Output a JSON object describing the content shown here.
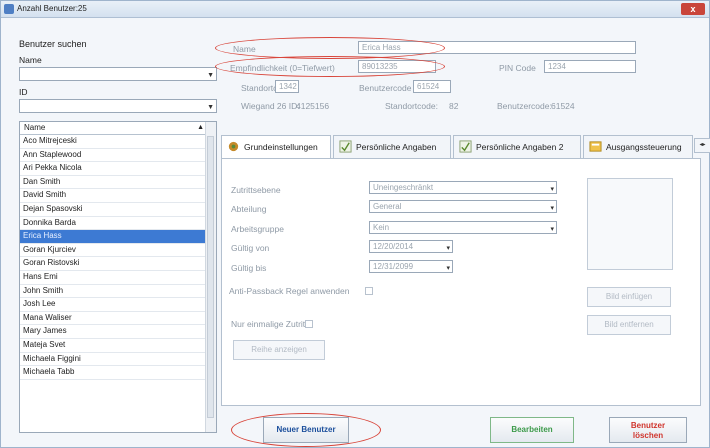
{
  "window": {
    "title": "Anzahl Benutzer:25",
    "close_glyph": "x"
  },
  "search": {
    "heading": "Benutzer suchen",
    "name_label": "Name",
    "id_label": "ID",
    "name_value": "",
    "id_value": ""
  },
  "list": {
    "header": "Name",
    "items": [
      "Aco Mitrejceski",
      "Ann Staplewood",
      "Ari Pekka Nicola",
      "Dan Smith",
      "David Smith",
      "Dejan Spasovski",
      "Donnika Barda",
      "Erica Hass",
      "Goran Kjurciev",
      "Goran Ristovski",
      "Hans Emi",
      "John Smith",
      "Josh Lee",
      "Mana Waliser",
      "Mary James",
      "Mateja Svet",
      "Michaela Figgini",
      "Michaela Tabb"
    ],
    "selected_index": 7
  },
  "details": {
    "name_label": "Name",
    "name_value": "Erica Hass",
    "card_label": "Empfindlichkeit (0=Tiefwert)",
    "card_value": "89013235",
    "pin_label": "PIN Code",
    "pin_value": "1234",
    "site_code_label": "Standortcode",
    "site_code_value": "1342",
    "user_code_label": "Benutzercode",
    "user_code_value": "61524",
    "wiegand_label": "Wiegand 26 ID:",
    "wiegand_value": "4125156",
    "site_code2_label": "Standortcode:",
    "site_code2_value": "82",
    "user_code2_label": "Benutzercode:",
    "user_code2_value": "61524"
  },
  "tabs": [
    {
      "label": "Grundeinstellungen",
      "icon": "gear-icon"
    },
    {
      "label": "Persönliche Angaben",
      "icon": "checklist-icon"
    },
    {
      "label": "Persönliche Angaben 2",
      "icon": "checklist-icon"
    },
    {
      "label": "Ausgangssteuerung",
      "icon": "output-icon"
    }
  ],
  "form": {
    "access_level_label": "Zutrittsebene",
    "access_level_value": "Uneingeschränkt",
    "department_label": "Abteilung",
    "department_value": "General",
    "workgroup_label": "Arbeitsgruppe",
    "workgroup_value": "Kein",
    "valid_from_label": "Gültig von",
    "valid_from_value": "12/20/2014",
    "valid_to_label": "Gültig bis",
    "valid_to_value": "12/31/2099",
    "antipassback_label": "Anti-Passback Regel anwenden",
    "one_time_label": "Nur einmalige Zutrit",
    "remove_display_label": "Reihe anzeigen",
    "insert_image_label": "Bild einfügen",
    "remove_image_label": "Bild entfernen"
  },
  "actions": {
    "new_user": "Neuer Benutzer",
    "edit": "Bearbeiten",
    "delete_line1": "Benutzer",
    "delete_line2": "löschen"
  },
  "colors": {
    "accent": "#3d7ad3",
    "annotation": "#d8453a",
    "edit_text": "#3c9a4a",
    "delete_text": "#d0342c"
  }
}
